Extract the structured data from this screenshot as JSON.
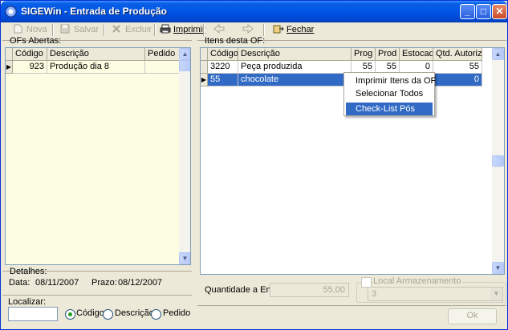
{
  "window": {
    "title": "SIGEWin - Entrada de Produção"
  },
  "titlebar_buttons": {
    "minimize": "_",
    "maximize": "□",
    "close": "✕"
  },
  "toolbar": {
    "new_label": "Nova",
    "save_label": "Salvar",
    "delete_label": "Excluir",
    "print_label": "Imprimir",
    "prev_icon": "arrow-left-icon",
    "next_icon": "arrow-right-icon",
    "close_label": "Fechar"
  },
  "left_panel": {
    "title": "OFs Abertas:",
    "columns": [
      "Código",
      "Descrição",
      "Pedido"
    ],
    "rows": [
      {
        "codigo": "923",
        "descricao": "Produção dia 8",
        "pedido": ""
      }
    ],
    "details": {
      "title": "Detalhes:",
      "data_label": "Data:",
      "data_value": "08/11/2007",
      "prazo_label": "Prazo:",
      "prazo_value": "08/12/2007"
    },
    "search": {
      "label": "Localizar:",
      "value": "",
      "options": [
        "Código",
        "Descrição",
        "Pedido"
      ],
      "selected": "Código"
    }
  },
  "right_panel": {
    "title": "Itens desta OF:",
    "columns": [
      "Código",
      "Descrição",
      "Prog",
      "Prod",
      "Estocado",
      "Qtd. Autorizado"
    ],
    "rows": [
      {
        "codigo": "3220",
        "descricao": "Peça produzida",
        "prog": "55",
        "prod": "55",
        "estocado": "0",
        "qtd": "55"
      },
      {
        "codigo": "55",
        "descricao": "chocolate",
        "prog": "",
        "prod": "",
        "estocado": "",
        "qtd": "0"
      }
    ],
    "quantity_label": "Quantidade a Entrar:",
    "quantity_value": "55,00",
    "storage_label": "Local Armazenamento",
    "storage_value": "3",
    "ok_label": "Ok"
  },
  "context_menu": {
    "items": [
      "Imprimir Itens da OF",
      "Selecionar Todos",
      "Check-List Pós"
    ],
    "highlighted": "Check-List Pós"
  },
  "colors": {
    "selection": "#316ac5",
    "titlebar": "#0055e5",
    "grid_yellow": "#fdfde2"
  }
}
